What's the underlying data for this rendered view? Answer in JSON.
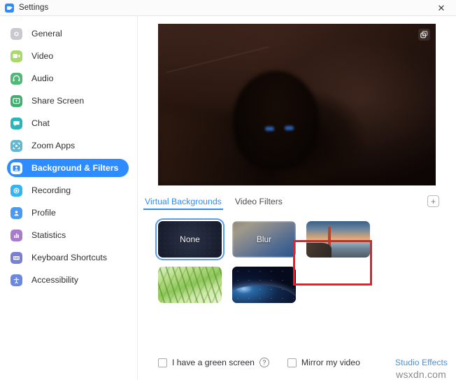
{
  "window": {
    "title": "Settings",
    "app_icon": "zoom-camera-icon",
    "close_label": "✕"
  },
  "sidebar": {
    "items": [
      {
        "label": "General",
        "icon": "gear-icon",
        "color": "#c9c9cf",
        "active": false
      },
      {
        "label": "Video",
        "icon": "video-camera-icon",
        "color": "#a9d96b",
        "active": false
      },
      {
        "label": "Audio",
        "icon": "headphones-icon",
        "color": "#52b878",
        "active": false
      },
      {
        "label": "Share Screen",
        "icon": "share-screen-icon",
        "color": "#3fae6e",
        "active": false
      },
      {
        "label": "Chat",
        "icon": "chat-bubble-icon",
        "color": "#2bb5b8",
        "active": false
      },
      {
        "label": "Zoom Apps",
        "icon": "zoom-apps-icon",
        "color": "#63b8cf",
        "active": false
      },
      {
        "label": "Background & Filters",
        "icon": "person-frame-icon",
        "color": "#2d8cff",
        "active": true
      },
      {
        "label": "Recording",
        "icon": "record-circle-icon",
        "color": "#34b4f0",
        "active": false
      },
      {
        "label": "Profile",
        "icon": "person-icon",
        "color": "#4a9bf0",
        "active": false
      },
      {
        "label": "Statistics",
        "icon": "bar-chart-icon",
        "color": "#a87ccb",
        "active": false
      },
      {
        "label": "Keyboard Shortcuts",
        "icon": "keyboard-icon",
        "color": "#7b7fd0",
        "active": false
      },
      {
        "label": "Accessibility",
        "icon": "accessibility-icon",
        "color": "#6b87e0",
        "active": false
      }
    ]
  },
  "preview": {
    "pip_icon": "picture-in-picture-icon"
  },
  "tabs": {
    "items": [
      {
        "label": "Virtual Backgrounds",
        "active": true
      },
      {
        "label": "Video Filters",
        "active": false
      }
    ],
    "add_label": "+",
    "add_icon": "plus-box-icon"
  },
  "backgrounds": {
    "items": [
      {
        "label": "None",
        "style": "th-none",
        "selected": true,
        "name": "background-none"
      },
      {
        "label": "Blur",
        "style": "th-blur",
        "selected": false,
        "name": "background-blur"
      },
      {
        "label": "",
        "style": "th-bridge",
        "selected": false,
        "name": "background-golden-gate-bridge"
      },
      {
        "label": "",
        "style": "th-grass",
        "selected": false,
        "name": "background-grass"
      },
      {
        "label": "",
        "style": "th-earth",
        "selected": false,
        "name": "background-earth-from-space"
      }
    ]
  },
  "controls": {
    "green_screen_label": "I have a green screen",
    "green_screen_checked": false,
    "help_icon": "question-mark-icon",
    "help_glyph": "?",
    "mirror_label": "Mirror my video",
    "mirror_checked": false,
    "studio_effects_label": "Studio Effects"
  },
  "watermark": {
    "text": "wsxdn.com"
  },
  "colors": {
    "accent": "#2d8cff",
    "link": "#4f8fd6",
    "annotation": "#ee1c25"
  }
}
